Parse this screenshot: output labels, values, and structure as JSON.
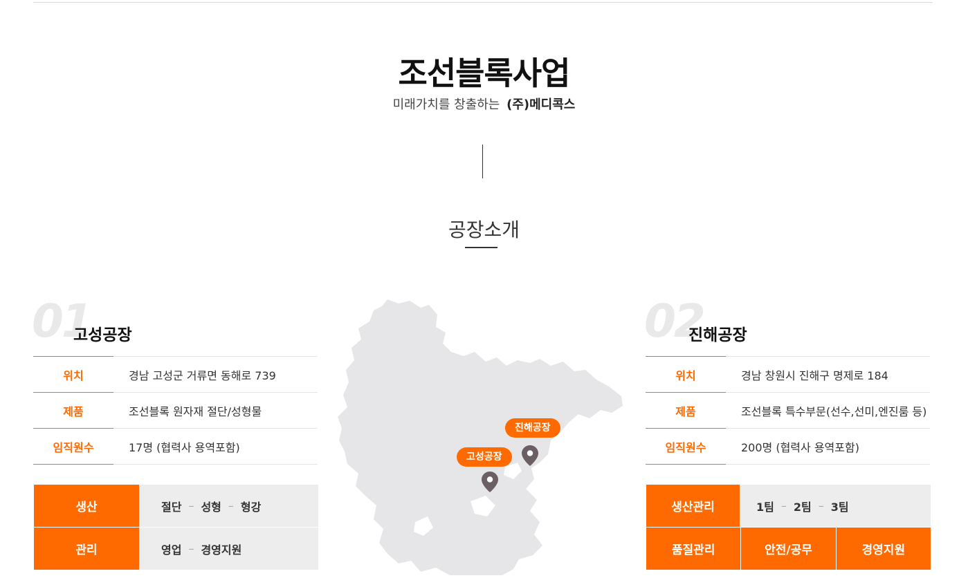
{
  "header": {
    "title": "조선블록사업",
    "subtitle_prefix": "미래가치를 창출하는",
    "subtitle_company": "(주)메디콕스"
  },
  "section": {
    "title": "공장소개"
  },
  "factories": [
    {
      "number": "01",
      "name": "고성공장",
      "info": [
        {
          "label": "위치",
          "value": "경남 고성군 거류면 동해로 739"
        },
        {
          "label": "제품",
          "value": "조선블록 원자재 절단/성형물"
        },
        {
          "label": "임직원수",
          "value": "17명 (협력사 용역포함)"
        }
      ],
      "org": {
        "production": {
          "label": "생산",
          "items": [
            "절단",
            "성형",
            "형강"
          ]
        },
        "management": {
          "label": "관리",
          "items": [
            "영업",
            "경영지원"
          ]
        }
      }
    },
    {
      "number": "02",
      "name": "진해공장",
      "info": [
        {
          "label": "위치",
          "value": "경남 창원시 진해구 명제로 184"
        },
        {
          "label": "제품",
          "value": "조선블록 특수부문(선수,선미,엔진룸 등)"
        },
        {
          "label": "임직원수",
          "value": "200명 (협력사 용역포함)"
        }
      ],
      "org": {
        "production": {
          "label": "생산관리",
          "items": [
            "1팀",
            "2팀",
            "3팀"
          ]
        },
        "bottom": [
          "품질관리",
          "안전/공무",
          "경영지원"
        ]
      }
    }
  ],
  "map": {
    "pins": [
      {
        "label": "진해공장",
        "icon": "map-pin-icon"
      },
      {
        "label": "고성공장",
        "icon": "map-pin-icon"
      }
    ]
  },
  "colors": {
    "accent": "#ff6a00",
    "map_land": "#e6e6e8",
    "pin": "#6b5f64"
  }
}
